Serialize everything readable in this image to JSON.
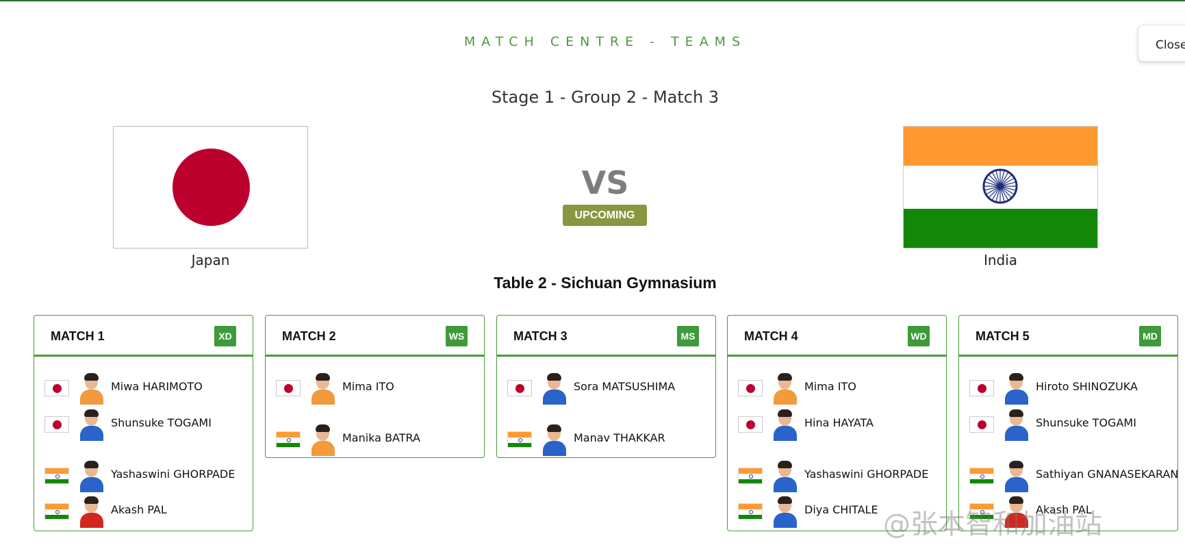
{
  "header": {
    "title": "MATCH CENTRE - TEAMS",
    "close_label": "Close"
  },
  "fixture": {
    "stage": "Stage 1 - Group 2 - Match 3",
    "home_team": "Japan",
    "away_team": "India",
    "vs_label": "VS",
    "status": "UPCOMING",
    "venue": "Table 2 - Sichuan Gymnasium"
  },
  "colors": {
    "accent_green": "#4a9a3a",
    "status_olive": "#8a9640",
    "japan_red": "#bc002d",
    "india_saffron": "#ff9a33",
    "india_green": "#138808",
    "india_navy": "#1d2d7a"
  },
  "matches": [
    {
      "title": "MATCH 1",
      "event": "XD",
      "players": [
        {
          "name": "Miwa HARIMOTO",
          "country": "jp",
          "kit": "orange"
        },
        {
          "name": "Shunsuke TOGAMI",
          "country": "jp",
          "kit": "blue"
        },
        {
          "name": "Yashaswini GHORPADE",
          "country": "in",
          "kit": "blue"
        },
        {
          "name": "Akash PAL",
          "country": "in",
          "kit": "red"
        }
      ]
    },
    {
      "title": "MATCH 2",
      "event": "WS",
      "players": [
        {
          "name": "Mima ITO",
          "country": "jp",
          "kit": "orange"
        },
        {
          "name": "Manika BATRA",
          "country": "in",
          "kit": "orange"
        }
      ]
    },
    {
      "title": "MATCH 3",
      "event": "MS",
      "players": [
        {
          "name": "Sora MATSUSHIMA",
          "country": "jp",
          "kit": "blue"
        },
        {
          "name": "Manav THAKKAR",
          "country": "in",
          "kit": "blue"
        }
      ]
    },
    {
      "title": "MATCH 4",
      "event": "WD",
      "players": [
        {
          "name": "Mima ITO",
          "country": "jp",
          "kit": "orange"
        },
        {
          "name": "Hina HAYATA",
          "country": "jp",
          "kit": "blue"
        },
        {
          "name": "Yashaswini GHORPADE",
          "country": "in",
          "kit": "blue"
        },
        {
          "name": "Diya CHITALE",
          "country": "in",
          "kit": "blue"
        }
      ]
    },
    {
      "title": "MATCH 5",
      "event": "MD",
      "players": [
        {
          "name": "Hiroto SHINOZUKA",
          "country": "jp",
          "kit": "blue"
        },
        {
          "name": "Shunsuke TOGAMI",
          "country": "jp",
          "kit": "blue"
        },
        {
          "name": "Sathiyan GNANASEKARAN",
          "country": "in",
          "kit": "blue"
        },
        {
          "name": "Akash PAL",
          "country": "in",
          "kit": "red"
        }
      ]
    }
  ],
  "watermark": "@张本智和加油站"
}
